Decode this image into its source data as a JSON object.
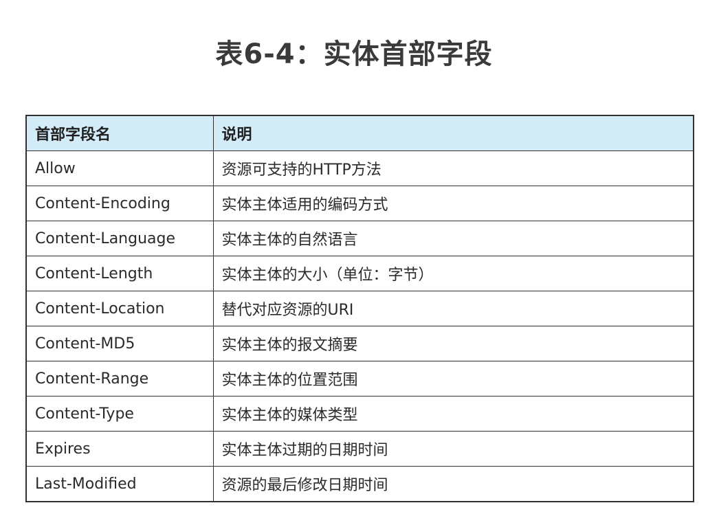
{
  "title": "表6-4：实体首部字段",
  "table": {
    "headers": [
      "首部字段名",
      "说明"
    ],
    "rows": [
      {
        "name": "Allow",
        "desc": "资源可支持的HTTP方法"
      },
      {
        "name": "Content-Encoding",
        "desc": "实体主体适用的编码方式"
      },
      {
        "name": "Content-Language",
        "desc": "实体主体的自然语言"
      },
      {
        "name": "Content-Length",
        "desc": "实体主体的大小（单位：字节）"
      },
      {
        "name": "Content-Location",
        "desc": "替代对应资源的URI"
      },
      {
        "name": "Content-MD5",
        "desc": "实体主体的报文摘要"
      },
      {
        "name": "Content-Range",
        "desc": "实体主体的位置范围"
      },
      {
        "name": "Content-Type",
        "desc": "实体主体的媒体类型"
      },
      {
        "name": "Expires",
        "desc": "实体主体过期的日期时间"
      },
      {
        "name": "Last-Modified",
        "desc": "资源的最后修改日期时间"
      }
    ]
  },
  "colors": {
    "header_background": "#d4ecf7",
    "border": "#2f2f2f",
    "title_text": "#3a3a3a"
  }
}
